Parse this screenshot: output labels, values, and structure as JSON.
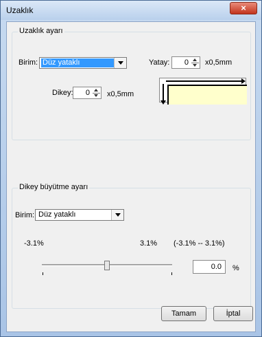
{
  "window": {
    "title": "Uzaklık",
    "close_glyph": "×"
  },
  "distance_group": {
    "label": "Uzaklık ayarı",
    "unit_label": "Birim:",
    "unit_value": "Düz yataklı",
    "horizontal_label": "Yatay:",
    "horizontal_value": "0",
    "horizontal_unit": "x0,5mm",
    "vertical_label": "Dikey:",
    "vertical_value": "0",
    "vertical_unit": "x0,5mm"
  },
  "scale_group": {
    "label": "Dikey büyütme ayarı",
    "unit_label": "Birim:",
    "unit_value": "Düz yataklı",
    "min_label": "-3.1%",
    "max_label": "3.1%",
    "range_label": "(-3.1% -- 3.1%)",
    "value": "0.0",
    "percent": "%",
    "slider_fraction": 0.5
  },
  "buttons": {
    "ok": "Tamam",
    "cancel": "İptal"
  },
  "icons": {
    "spin": "spin-up-down-icon",
    "dropdown": "chevron-down-icon",
    "close": "close-icon"
  }
}
